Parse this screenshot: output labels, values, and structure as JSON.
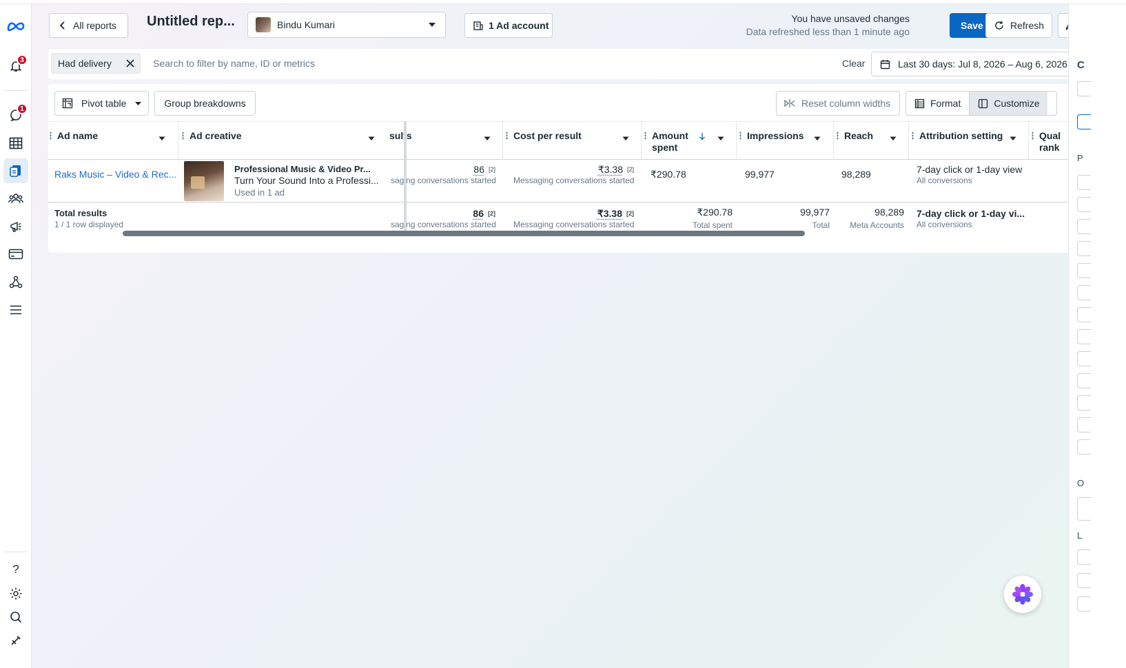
{
  "header": {
    "back_label": "All reports",
    "title": "Untitled rep...",
    "account_selector": "Bindu Kumari",
    "ad_account_label": "1 Ad account",
    "status_unsaved": "You have unsaved changes",
    "status_refreshed": "Data refreshed less than 1 minute ago",
    "save_label": "Save",
    "refresh_label": "Refresh"
  },
  "rail": {
    "notifications_badge": "3",
    "messages_badge": "1",
    "help_glyph": "?"
  },
  "filter": {
    "chip_label": "Had delivery",
    "search_placeholder": "Search to filter by name, ID or metrics",
    "clear_label": "Clear",
    "date_range": "Last 30 days: Jul 8, 2026 – Aug 6, 2026"
  },
  "toolbar": {
    "pivot_label": "Pivot table",
    "group_label": "Group breakdowns",
    "reset_label": "Reset column widths",
    "format_label": "Format",
    "customize_label": "Customize"
  },
  "columns": {
    "ad_name": "Ad name",
    "ad_creative": "Ad creative",
    "results": "sults",
    "cost_per_result": "Cost per result",
    "amount_spent_1": "Amount",
    "amount_spent_2": "spent",
    "impressions": "Impressions",
    "reach": "Reach",
    "attribution": "Attribution setting",
    "quality_1": "Qual",
    "quality_2": "rank"
  },
  "row": {
    "ad_name": "Raks Music – Video & Rec...",
    "creative_title": "Professional Music & Video Pr...",
    "creative_body": "Turn Your Sound Into a Professi...",
    "creative_used": "Used in 1 ad",
    "results_value": "86",
    "results_foot": "[2]",
    "results_sub": "saging conversations started",
    "cpr_value": "₹3.38",
    "cpr_foot": "[2]",
    "cpr_sub": "Messaging conversations started",
    "amount": "₹290.78",
    "impressions": "99,977",
    "reach": "98,289",
    "attribution": "7-day click or 1-day view",
    "attribution_sub": "All conversions"
  },
  "totals": {
    "label": "Total results",
    "rows_displayed": "1 / 1 row displayed",
    "results_value": "86",
    "results_foot": "[2]",
    "results_sub": "saging conversations started",
    "cpr_value": "₹3.38",
    "cpr_foot": "[2]",
    "cpr_sub": "Messaging conversations started",
    "amount": "₹290.78",
    "amount_sub": "Total spent",
    "impressions": "99,977",
    "impressions_sub": "Total",
    "reach": "98,289",
    "reach_sub": "Meta Accounts",
    "attribution": "7-day click or 1-day vi...",
    "attribution_sub": "All conversions"
  },
  "right_panel": {
    "letter_c": "C",
    "letter_p": "P",
    "letter_o": "O",
    "letter_l": "L"
  },
  "colors": {
    "accent": "#0a66c2",
    "link": "#1a6fc2",
    "badge": "#c4122f"
  }
}
